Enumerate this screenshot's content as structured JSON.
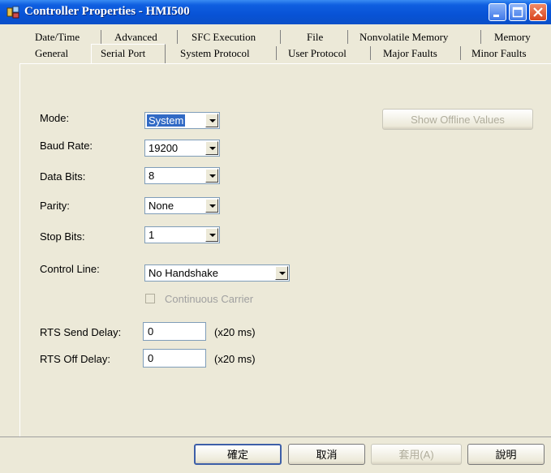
{
  "window": {
    "title": "Controller Properties - HMI500",
    "icon": "controller-app-icon",
    "controls": [
      "minimize-icon",
      "maximize-icon",
      "close-icon"
    ]
  },
  "tabs": {
    "row1": [
      "Date/Time",
      "Advanced",
      "SFC Execution",
      "File",
      "Nonvolatile Memory",
      "Memory"
    ],
    "row2": [
      "General",
      "Serial Port",
      "System Protocol",
      "User Protocol",
      "Major Faults",
      "Minor Faults"
    ],
    "active": "Serial Port"
  },
  "form": {
    "mode": {
      "label": "Mode:",
      "value": "System"
    },
    "baud_rate": {
      "label": "Baud Rate:",
      "value": "19200"
    },
    "data_bits": {
      "label": "Data Bits:",
      "value": "8"
    },
    "parity": {
      "label": "Parity:",
      "value": "None"
    },
    "stop_bits": {
      "label": "Stop Bits:",
      "value": "1"
    },
    "control_line": {
      "label": "Control Line:",
      "value": "No Handshake"
    },
    "continuous_carrier": {
      "label": "Continuous Carrier",
      "checked": false,
      "enabled": false
    },
    "rts_send_delay": {
      "label": "RTS Send Delay:",
      "value": "0",
      "unit": "(x20 ms)"
    },
    "rts_off_delay": {
      "label": "RTS Off Delay:",
      "value": "0",
      "unit": "(x20 ms)"
    },
    "show_offline_values": {
      "label": "Show Offline Values",
      "enabled": false
    }
  },
  "buttons": {
    "ok": "確定",
    "cancel": "取消",
    "apply": "套用(A)",
    "help": "說明"
  },
  "colors": {
    "title_bar": "#0853d6",
    "dialog_bg": "#ece9d8",
    "selection": "#316ac5"
  }
}
